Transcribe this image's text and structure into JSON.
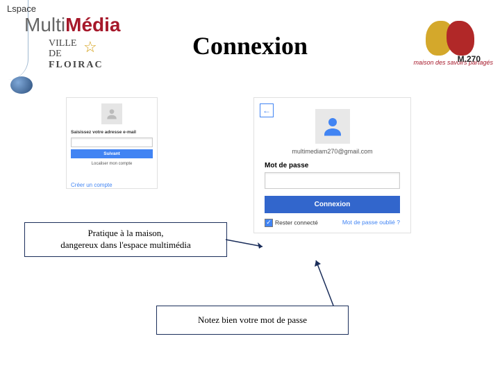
{
  "header": {
    "lspace": "Lspace",
    "multi_part1": "Multi",
    "multi_part2": "Média",
    "ville_line1": "VILLE",
    "ville_line2": "DE",
    "ville_line3": "FLOIRAC",
    "title": "Connexion",
    "m270": "M.270",
    "maison": "maison des savoirs partagés"
  },
  "panel_left": {
    "label": "Saisissez votre adresse e-mail",
    "button": "Suivant",
    "locate": "Localiser mon compte",
    "create": "Créer un compte"
  },
  "panel_right": {
    "email": "multimediam270@gmail.com",
    "pw_label": "Mot de passe",
    "button": "Connexion",
    "stay": "Rester connecté",
    "forgot": "Mot de passe oublié ?"
  },
  "callouts": {
    "c1_line1": "Pratique à la maison,",
    "c1_line2": "dangereux dans l'espace multimédia",
    "c2": "Notez bien votre mot de passe"
  }
}
